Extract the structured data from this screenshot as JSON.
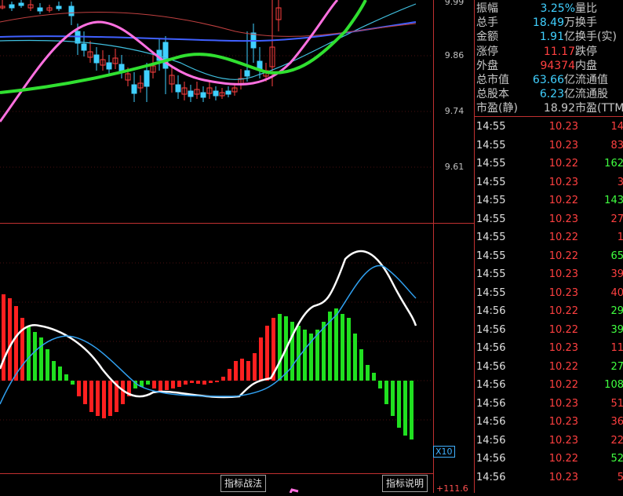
{
  "price_axis": {
    "labels": [
      "9.99",
      "9.86",
      "9.74",
      "9.61"
    ]
  },
  "indicator": {
    "x_label": "X10",
    "macd_value": "+111.6"
  },
  "buttons": {
    "strategy": "指标战法",
    "explain": "指标说明"
  },
  "stats": [
    {
      "k": "振幅",
      "v": "3.25%",
      "u": "",
      "color": "#40d0ff",
      "k2": "量比"
    },
    {
      "k": "总手",
      "v": "18.49",
      "u": "万",
      "color": "#40d0ff",
      "k2": "换手"
    },
    {
      "k": "金额",
      "v": "1.91",
      "u": "亿",
      "color": "#40d0ff",
      "k2": "换手(实)"
    },
    {
      "k": "涨停",
      "v": "11.17",
      "u": "",
      "color": "#ff4040",
      "k2": "跌停"
    },
    {
      "k": "外盘",
      "v": "94374",
      "u": "",
      "color": "#ff4040",
      "k2": "内盘"
    },
    {
      "k": "总市值",
      "v": "63.66",
      "u": "亿",
      "color": "#40d0ff",
      "k2": "流通值"
    },
    {
      "k": "总股本",
      "v": "6.23",
      "u": "亿",
      "color": "#40d0ff",
      "k2": "流通股"
    },
    {
      "k": "市盈(静)",
      "v": "18.92",
      "u": "",
      "color": "#c8c8c8",
      "k2": "市盈(TTM"
    }
  ],
  "ticks": [
    {
      "t": "14:55",
      "p": "10.23",
      "v": "14",
      "pc": "#ff4040",
      "vc": "#ff4040"
    },
    {
      "t": "14:55",
      "p": "10.23",
      "v": "83",
      "pc": "#ff4040",
      "vc": "#ff4040"
    },
    {
      "t": "14:55",
      "p": "10.22",
      "v": "162",
      "pc": "#ff4040",
      "vc": "#40ff40"
    },
    {
      "t": "14:55",
      "p": "10.23",
      "v": "3",
      "pc": "#ff4040",
      "vc": "#ff4040"
    },
    {
      "t": "14:55",
      "p": "10.22",
      "v": "143",
      "pc": "#ff4040",
      "vc": "#40ff40"
    },
    {
      "t": "14:55",
      "p": "10.23",
      "v": "27",
      "pc": "#ff4040",
      "vc": "#ff4040"
    },
    {
      "t": "14:55",
      "p": "10.22",
      "v": "1",
      "pc": "#ff4040",
      "vc": "#ff4040"
    },
    {
      "t": "14:55",
      "p": "10.22",
      "v": "65",
      "pc": "#ff4040",
      "vc": "#40ff40"
    },
    {
      "t": "14:55",
      "p": "10.23",
      "v": "39",
      "pc": "#ff4040",
      "vc": "#ff4040"
    },
    {
      "t": "14:55",
      "p": "10.23",
      "v": "40",
      "pc": "#ff4040",
      "vc": "#ff4040"
    },
    {
      "t": "14:56",
      "p": "10.22",
      "v": "29",
      "pc": "#ff4040",
      "vc": "#40ff40"
    },
    {
      "t": "14:56",
      "p": "10.22",
      "v": "39",
      "pc": "#ff4040",
      "vc": "#40ff40"
    },
    {
      "t": "14:56",
      "p": "10.23",
      "v": "11",
      "pc": "#ff4040",
      "vc": "#ff4040"
    },
    {
      "t": "14:56",
      "p": "10.22",
      "v": "27",
      "pc": "#ff4040",
      "vc": "#40ff40"
    },
    {
      "t": "14:56",
      "p": "10.22",
      "v": "108",
      "pc": "#ff4040",
      "vc": "#40ff40"
    },
    {
      "t": "14:56",
      "p": "10.23",
      "v": "51",
      "pc": "#ff4040",
      "vc": "#ff4040"
    },
    {
      "t": "14:56",
      "p": "10.23",
      "v": "36",
      "pc": "#ff4040",
      "vc": "#ff4040"
    },
    {
      "t": "14:56",
      "p": "10.23",
      "v": "22",
      "pc": "#ff4040",
      "vc": "#ff4040"
    },
    {
      "t": "14:56",
      "p": "10.22",
      "v": "52",
      "pc": "#ff4040",
      "vc": "#40ff40"
    },
    {
      "t": "14:56",
      "p": "10.23",
      "v": "5",
      "pc": "#ff4040",
      "vc": "#ff4040"
    }
  ],
  "colors": {
    "up": "#ff4040",
    "down": "#40d0ff",
    "grid": "#c03030"
  }
}
